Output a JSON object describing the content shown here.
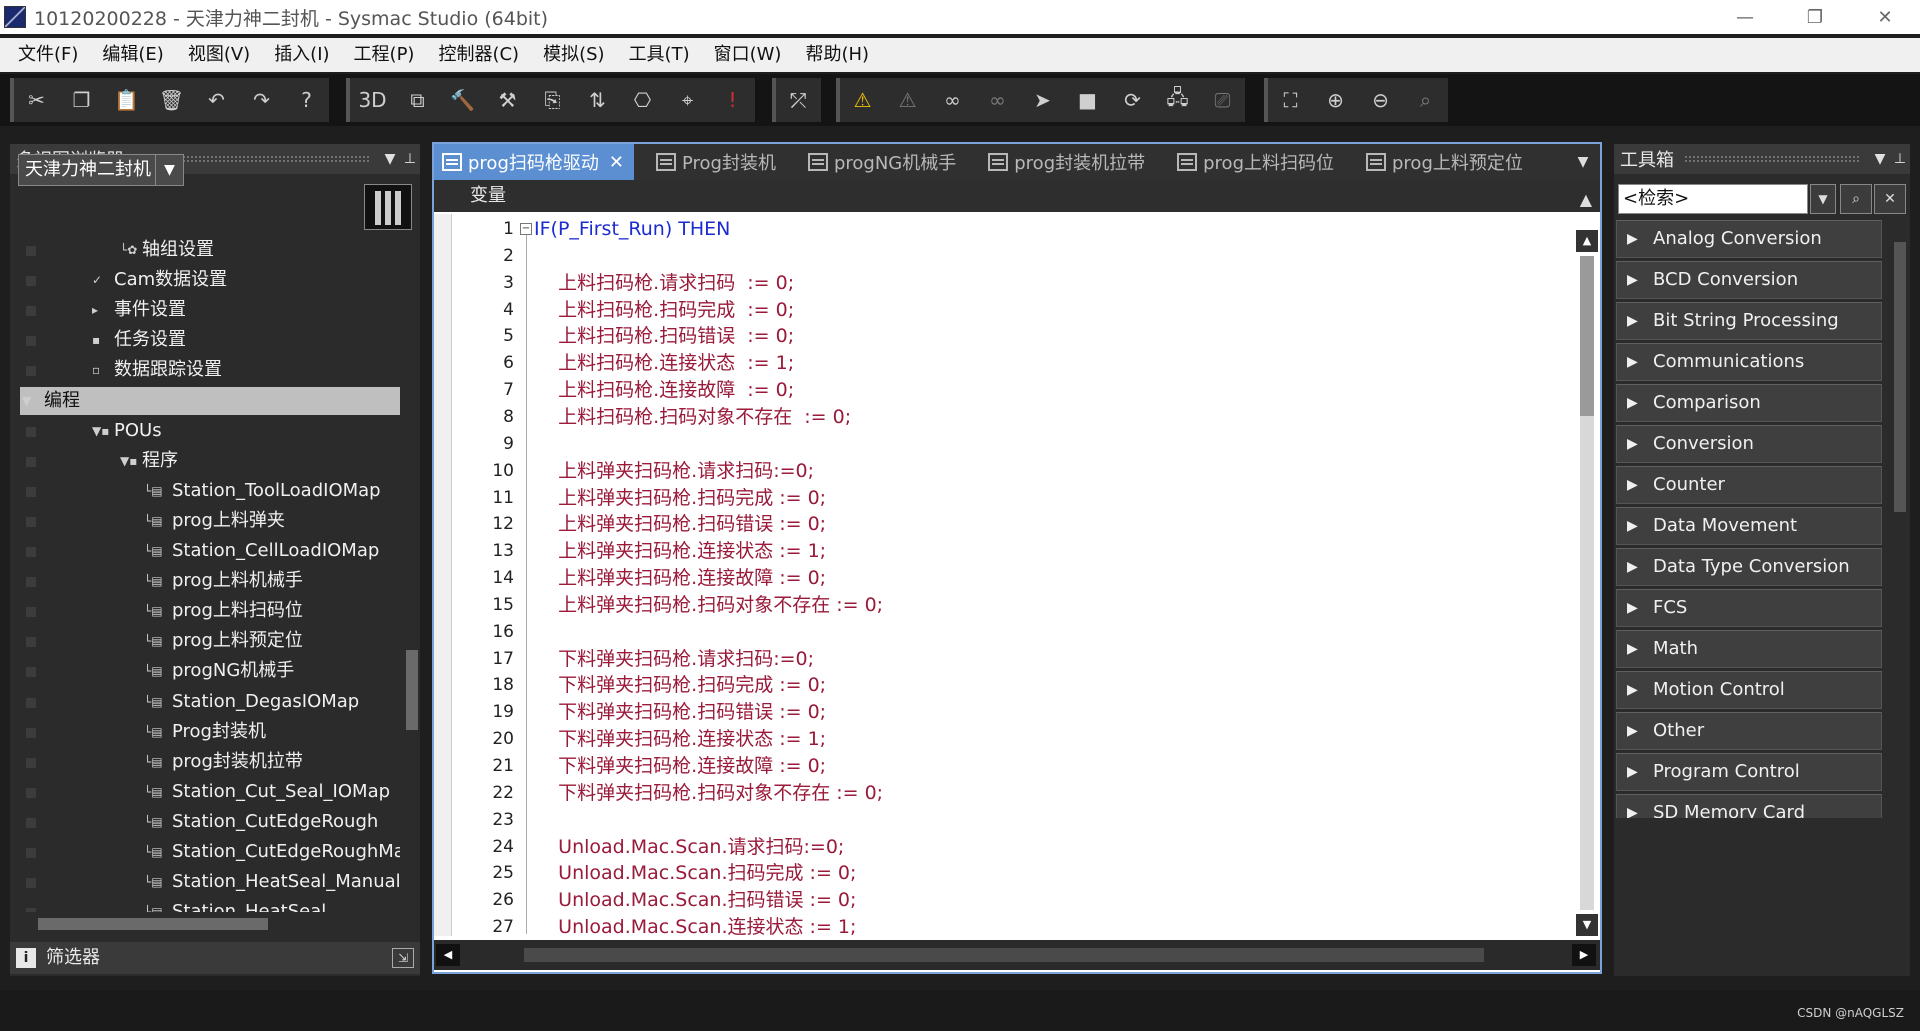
{
  "window": {
    "title": "10120200228 - 天津力神二封机 - Sysmac Studio (64bit)",
    "minimize": "—",
    "restore": "❐",
    "close": "✕"
  },
  "menu": [
    "文件(F)",
    "编辑(E)",
    "视图(V)",
    "插入(I)",
    "工程(P)",
    "控制器(C)",
    "模拟(S)",
    "工具(T)",
    "窗口(W)",
    "帮助(H)"
  ],
  "toolbar": {
    "groups": [
      [
        {
          "name": "cut-icon",
          "glyph": "✂"
        },
        {
          "name": "copy-icon",
          "glyph": "❐"
        },
        {
          "name": "paste-icon",
          "glyph": "📋"
        },
        {
          "name": "delete-icon",
          "glyph": "🗑"
        },
        {
          "name": "undo-icon",
          "glyph": "↶"
        },
        {
          "name": "redo-icon",
          "glyph": "↷"
        },
        {
          "name": "help-icon",
          "glyph": "?"
        }
      ],
      [
        {
          "name": "3d-icon",
          "glyph": "3D"
        },
        {
          "name": "window-icon",
          "glyph": "⧉"
        },
        {
          "name": "build-icon",
          "glyph": "🔨"
        },
        {
          "name": "rebuild-icon",
          "glyph": "⚒"
        },
        {
          "name": "compare-icon",
          "glyph": "⎘"
        },
        {
          "name": "transfer-icon",
          "glyph": "⇅"
        },
        {
          "name": "network-icon",
          "glyph": "⎔"
        },
        {
          "name": "find-icon",
          "glyph": "⌖"
        },
        {
          "name": "error-icon",
          "glyph": "!"
        }
      ],
      [
        {
          "name": "cross-ref-icon",
          "glyph": "⤱"
        }
      ],
      [
        {
          "name": "warning-icon",
          "glyph": "⚠"
        },
        {
          "name": "warning-off-icon",
          "glyph": "⚠"
        },
        {
          "name": "watch-icon",
          "glyph": "∞"
        },
        {
          "name": "watch-off-icon",
          "glyph": "∞"
        },
        {
          "name": "step-icon",
          "glyph": "➤"
        },
        {
          "name": "stop-icon",
          "glyph": "■"
        },
        {
          "name": "refresh-icon",
          "glyph": "⟳"
        },
        {
          "name": "online-icon",
          "glyph": "🖧"
        },
        {
          "name": "offline-icon",
          "glyph": "⎚"
        }
      ],
      [
        {
          "name": "fit-icon",
          "glyph": "⛶"
        },
        {
          "name": "zoom-in-icon",
          "glyph": "⊕"
        },
        {
          "name": "zoom-out-icon",
          "glyph": "⊖"
        },
        {
          "name": "zoom-reset-icon",
          "glyph": "⌕"
        }
      ]
    ]
  },
  "navigator": {
    "title": "多视图浏览器",
    "device": "天津力神二封机",
    "items": [
      {
        "label": "轴组设置",
        "indent": 2,
        "icon": "└✿"
      },
      {
        "label": "Cam数据设置",
        "indent": 1,
        "icon": "✓"
      },
      {
        "label": "事件设置",
        "indent": 1,
        "icon": "▸"
      },
      {
        "label": "任务设置",
        "indent": 1,
        "icon": "▪"
      },
      {
        "label": "数据跟踪设置",
        "indent": 1,
        "icon": "▫"
      },
      {
        "label": "编程",
        "indent": 0,
        "icon": "▼",
        "selected": true
      },
      {
        "label": "POUs",
        "indent": 1,
        "icon": "▼▪"
      },
      {
        "label": "程序",
        "indent": 2,
        "icon": "▼▪"
      },
      {
        "label": "Station_ToolLoadIOMap",
        "indent": 3,
        "icon": "└▤"
      },
      {
        "label": "prog上料弹夹",
        "indent": 3,
        "icon": "└▤"
      },
      {
        "label": "Station_CellLoadIOMap",
        "indent": 3,
        "icon": "└▤"
      },
      {
        "label": "prog上料机械手",
        "indent": 3,
        "icon": "└▤"
      },
      {
        "label": "prog上料扫码位",
        "indent": 3,
        "icon": "└▤"
      },
      {
        "label": "prog上料预定位",
        "indent": 3,
        "icon": "└▤"
      },
      {
        "label": "progNG机械手",
        "indent": 3,
        "icon": "└▤"
      },
      {
        "label": "Station_DegasIOMap",
        "indent": 3,
        "icon": "└▤"
      },
      {
        "label": "Prog封装机",
        "indent": 3,
        "icon": "└▤"
      },
      {
        "label": "prog封装机拉带",
        "indent": 3,
        "icon": "└▤"
      },
      {
        "label": "Station_Cut_Seal_IOMap",
        "indent": 3,
        "icon": "└▤"
      },
      {
        "label": "Station_CutEdgeRough",
        "indent": 3,
        "icon": "└▤"
      },
      {
        "label": "Station_CutEdgeRoughManual",
        "indent": 3,
        "icon": "└▤"
      },
      {
        "label": "Station_HeatSeal_Manual",
        "indent": 3,
        "icon": "└▤"
      },
      {
        "label": "Station_HeatSeal",
        "indent": 3,
        "icon": "└▤"
      }
    ],
    "filter_label": "筛选器"
  },
  "editor": {
    "tabs": [
      {
        "label": "prog扫码枪驱动",
        "active": true
      },
      {
        "label": "Prog封装机",
        "active": false
      },
      {
        "label": "progNG机械手",
        "active": false
      },
      {
        "label": "prog封装机拉带",
        "active": false
      },
      {
        "label": "prog上料扫码位",
        "active": false
      },
      {
        "label": "prog上料预定位",
        "active": false
      }
    ],
    "variables_label": "变量",
    "lines": [
      {
        "n": "1",
        "text": "IF(P_First_Run) THEN",
        "kind": "kw"
      },
      {
        "n": "2",
        "text": "",
        "kind": "code"
      },
      {
        "n": "3",
        "text": "    上料扫码枪.请求扫码  := 0;",
        "kind": "code"
      },
      {
        "n": "4",
        "text": "    上料扫码枪.扫码完成  := 0;",
        "kind": "code"
      },
      {
        "n": "5",
        "text": "    上料扫码枪.扫码错误  := 0;",
        "kind": "code"
      },
      {
        "n": "6",
        "text": "    上料扫码枪.连接状态  := 1;",
        "kind": "code"
      },
      {
        "n": "7",
        "text": "    上料扫码枪.连接故障  := 0;",
        "kind": "code"
      },
      {
        "n": "8",
        "text": "    上料扫码枪.扫码对象不存在  := 0;",
        "kind": "code"
      },
      {
        "n": "9",
        "text": "",
        "kind": "code"
      },
      {
        "n": "10",
        "text": "    上料弹夹扫码枪.请求扫码:=0;",
        "kind": "code"
      },
      {
        "n": "11",
        "text": "    上料弹夹扫码枪.扫码完成 := 0;",
        "kind": "code"
      },
      {
        "n": "12",
        "text": "    上料弹夹扫码枪.扫码错误 := 0;",
        "kind": "code"
      },
      {
        "n": "13",
        "text": "    上料弹夹扫码枪.连接状态 := 1;",
        "kind": "code"
      },
      {
        "n": "14",
        "text": "    上料弹夹扫码枪.连接故障 := 0;",
        "kind": "code"
      },
      {
        "n": "15",
        "text": "    上料弹夹扫码枪.扫码对象不存在 := 0;",
        "kind": "code"
      },
      {
        "n": "16",
        "text": "",
        "kind": "code"
      },
      {
        "n": "17",
        "text": "    下料弹夹扫码枪.请求扫码:=0;",
        "kind": "code"
      },
      {
        "n": "18",
        "text": "    下料弹夹扫码枪.扫码完成 := 0;",
        "kind": "code"
      },
      {
        "n": "19",
        "text": "    下料弹夹扫码枪.扫码错误 := 0;",
        "kind": "code"
      },
      {
        "n": "20",
        "text": "    下料弹夹扫码枪.连接状态 := 1;",
        "kind": "code"
      },
      {
        "n": "21",
        "text": "    下料弹夹扫码枪.连接故障 := 0;",
        "kind": "code"
      },
      {
        "n": "22",
        "text": "    下料弹夹扫码枪.扫码对象不存在 := 0;",
        "kind": "code"
      },
      {
        "n": "23",
        "text": "",
        "kind": "code"
      },
      {
        "n": "24",
        "text": "    Unload.Mac.Scan.请求扫码:=0;",
        "kind": "code"
      },
      {
        "n": "25",
        "text": "    Unload.Mac.Scan.扫码完成 := 0;",
        "kind": "code"
      },
      {
        "n": "26",
        "text": "    Unload.Mac.Scan.扫码错误 := 0;",
        "kind": "code"
      },
      {
        "n": "27",
        "text": "    Unload.Mac.Scan.连接状态 := 1;",
        "kind": "code"
      }
    ]
  },
  "toolbox": {
    "title": "工具箱",
    "search_placeholder": "<检索>",
    "categories": [
      "Analog Conversion",
      "BCD Conversion",
      "Bit String Processing",
      "Communications",
      "Comparison",
      "Conversion",
      "Counter",
      "Data Movement",
      "Data Type Conversion",
      "FCS",
      "Math",
      "Motion Control",
      "Other",
      "Program Control",
      "SD Memory Card"
    ]
  },
  "watermark": "CSDN @nAQGLSZ",
  "colors": {
    "accent": "#5b8fd1",
    "code": "#9a1a3a",
    "keyword": "#1c2bd0"
  }
}
